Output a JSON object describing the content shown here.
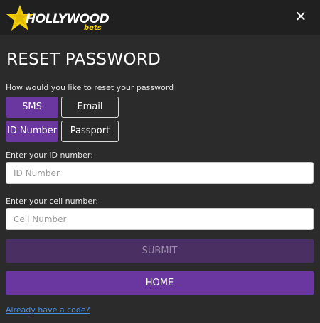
{
  "header": {
    "logo_text": "HOLLYWOOD",
    "logo_sub": "bets",
    "close_symbol": "✕"
  },
  "title": "RESET PASSWORD",
  "reset_method": {
    "label": "How would you like to reset your password",
    "options": [
      "SMS",
      "Email"
    ],
    "selected": "SMS"
  },
  "id_type": {
    "options": [
      "ID Number",
      "Passport"
    ],
    "selected": "ID Number"
  },
  "id_field": {
    "label": "Enter your ID number:",
    "placeholder": "ID Number",
    "value": ""
  },
  "cell_field": {
    "label": "Enter your cell number:",
    "placeholder": "Cell Number",
    "value": ""
  },
  "buttons": {
    "submit": "SUBMIT",
    "home": "HOME"
  },
  "link": "Already have a code?",
  "colors": {
    "accent": "#6a37a0",
    "submit_disabled": "#4a2f62",
    "background": "#2b2b2b",
    "header": "#202020",
    "logo_star": "#f5d000",
    "link": "#4a90e2"
  }
}
